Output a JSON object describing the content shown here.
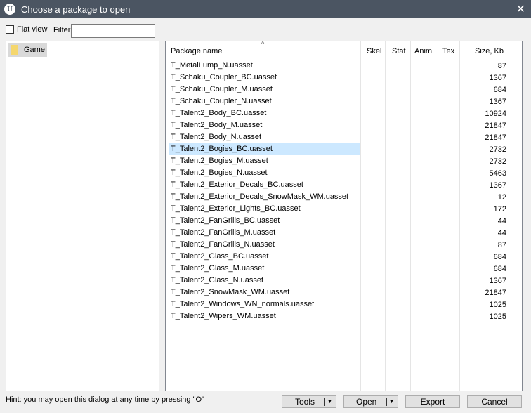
{
  "window": {
    "title": "Choose a package to open",
    "close": "✕"
  },
  "toolbar": {
    "flat_view_label": "Flat view",
    "flat_view_checked": false,
    "filter_label": "Filter:",
    "filter_value": ""
  },
  "tree": {
    "items": [
      {
        "label": "Game"
      }
    ]
  },
  "list": {
    "columns": [
      "Package name",
      "Skel",
      "Stat",
      "Anim",
      "Tex",
      "Size, Kb"
    ],
    "rows": [
      {
        "name": "T_MetalLump_N.uasset",
        "size": "87"
      },
      {
        "name": "T_Schaku_Coupler_BC.uasset",
        "size": "1367"
      },
      {
        "name": "T_Schaku_Coupler_M.uasset",
        "size": "684"
      },
      {
        "name": "T_Schaku_Coupler_N.uasset",
        "size": "1367"
      },
      {
        "name": "T_Talent2_Body_BC.uasset",
        "size": "10924"
      },
      {
        "name": "T_Talent2_Body_M.uasset",
        "size": "21847"
      },
      {
        "name": "T_Talent2_Body_N.uasset",
        "size": "21847"
      },
      {
        "name": "T_Talent2_Bogies_BC.uasset",
        "size": "2732",
        "selected": true
      },
      {
        "name": "T_Talent2_Bogies_M.uasset",
        "size": "2732"
      },
      {
        "name": "T_Talent2_Bogies_N.uasset",
        "size": "5463"
      },
      {
        "name": "T_Talent2_Exterior_Decals_BC.uasset",
        "size": "1367"
      },
      {
        "name": "T_Talent2_Exterior_Decals_SnowMask_WM.uasset",
        "size": "12"
      },
      {
        "name": "T_Talent2_Exterior_Lights_BC.uasset",
        "size": "172"
      },
      {
        "name": "T_Talent2_FanGrills_BC.uasset",
        "size": "44"
      },
      {
        "name": "T_Talent2_FanGrills_M.uasset",
        "size": "44"
      },
      {
        "name": "T_Talent2_FanGrills_N.uasset",
        "size": "87"
      },
      {
        "name": "T_Talent2_Glass_BC.uasset",
        "size": "684"
      },
      {
        "name": "T_Talent2_Glass_M.uasset",
        "size": "684"
      },
      {
        "name": "T_Talent2_Glass_N.uasset",
        "size": "1367"
      },
      {
        "name": "T_Talent2_SnowMask_WM.uasset",
        "size": "21847"
      },
      {
        "name": "T_Talent2_Windows_WN_normals.uasset",
        "size": "1025"
      },
      {
        "name": "T_Talent2_Wipers_WM.uasset",
        "size": "1025"
      }
    ]
  },
  "footer": {
    "hint": "Hint: you may open this dialog at any time by pressing \"O\"",
    "tools": "Tools",
    "open": "Open",
    "export": "Export",
    "cancel": "Cancel"
  }
}
